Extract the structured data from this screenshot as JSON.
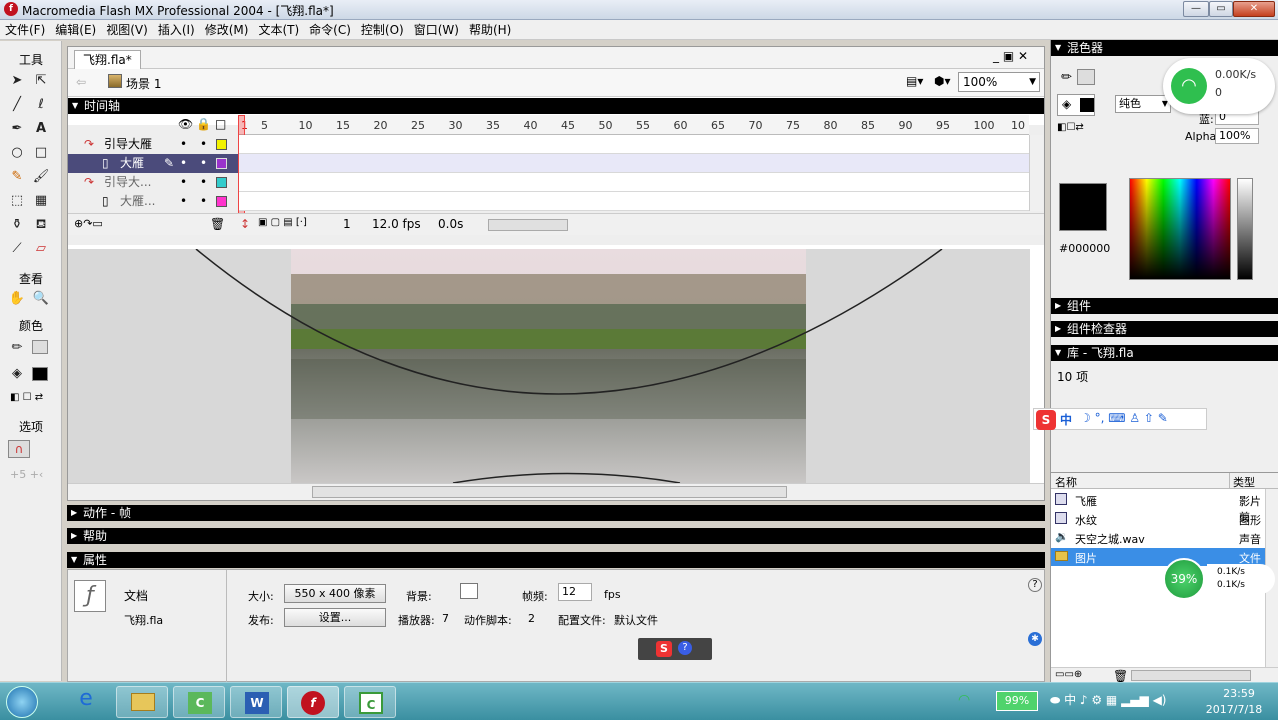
{
  "window": {
    "title": "Macromedia Flash MX Professional 2004 - [飞翔.fla*]",
    "minimize": "—",
    "maximize": "▭",
    "close": "✕"
  },
  "menu": [
    "文件(F)",
    "编辑(E)",
    "视图(V)",
    "插入(I)",
    "修改(M)",
    "文本(T)",
    "命令(C)",
    "控制(O)",
    "窗口(W)",
    "帮助(H)"
  ],
  "tools": {
    "title": "工具",
    "view_title": "查看",
    "color_title": "颜色",
    "options_title": "选项"
  },
  "document": {
    "tab": "飞翔.fla*",
    "scene": "场景 1",
    "zoom": "100%"
  },
  "timeline": {
    "title": "时间轴",
    "frame_numbers": [
      "1",
      "5",
      "10",
      "15",
      "20",
      "25",
      "30",
      "35",
      "40",
      "45",
      "50",
      "55",
      "60",
      "65",
      "70",
      "75",
      "80",
      "85",
      "90",
      "95",
      "100",
      "10"
    ],
    "layers": [
      {
        "name": "引导大雁",
        "type": "guide",
        "color": "#f2f200"
      },
      {
        "name": "大雁",
        "type": "normal",
        "color": "#9933cc"
      },
      {
        "name": "引导大...",
        "type": "guide",
        "color": "#33cccc"
      },
      {
        "name": "大雁...",
        "type": "normal",
        "color": "#ff33cc"
      }
    ],
    "current_frame": "1",
    "fps": "12.0 fps",
    "time": "0.0s"
  },
  "panels": {
    "actions": "动作 - 帧",
    "help": "帮助",
    "properties": "属性"
  },
  "properties": {
    "doc_label": "文档",
    "doc_name": "飞翔.fla",
    "size_label": "大小:",
    "size_value": "550 x 400 像素",
    "bg_label": "背景:",
    "fps_label": "帧频:",
    "fps_value": "12",
    "fps_unit": "fps",
    "publish_label": "发布:",
    "settings_button": "设置...",
    "player_label": "播放器:",
    "player_value": "7",
    "script_label": "动作脚本:",
    "script_value": "2",
    "profile_label": "配置文件:",
    "profile_value": "默认文件"
  },
  "color_mixer": {
    "title": "混色器",
    "fill_type": "纯色",
    "blue_label": "蓝:",
    "blue_value": "0",
    "alpha_label": "Alpha:",
    "alpha_value": "100%",
    "hex": "#000000"
  },
  "net_widget": {
    "up": "0.00K/s",
    "down": "0"
  },
  "components": {
    "title": "组件",
    "inspector": "组件检查器"
  },
  "library": {
    "title": "库 - 飞翔.fla",
    "count": "10 项",
    "col_name": "名称",
    "col_type": "类型",
    "items": [
      {
        "name": "飞雁",
        "type": "影片剪"
      },
      {
        "name": "水纹",
        "type": "图形"
      },
      {
        "name": "天空之城.wav",
        "type": "声音"
      },
      {
        "name": "图片",
        "type": "文件夹"
      }
    ]
  },
  "ime": {
    "label": "中"
  },
  "speed_widget": {
    "percent": "39%",
    "up": "0.1K/s",
    "down": "0.1K/s"
  },
  "taskbar": {
    "battery": "99%",
    "time": "23:59",
    "date": "2017/7/18"
  }
}
